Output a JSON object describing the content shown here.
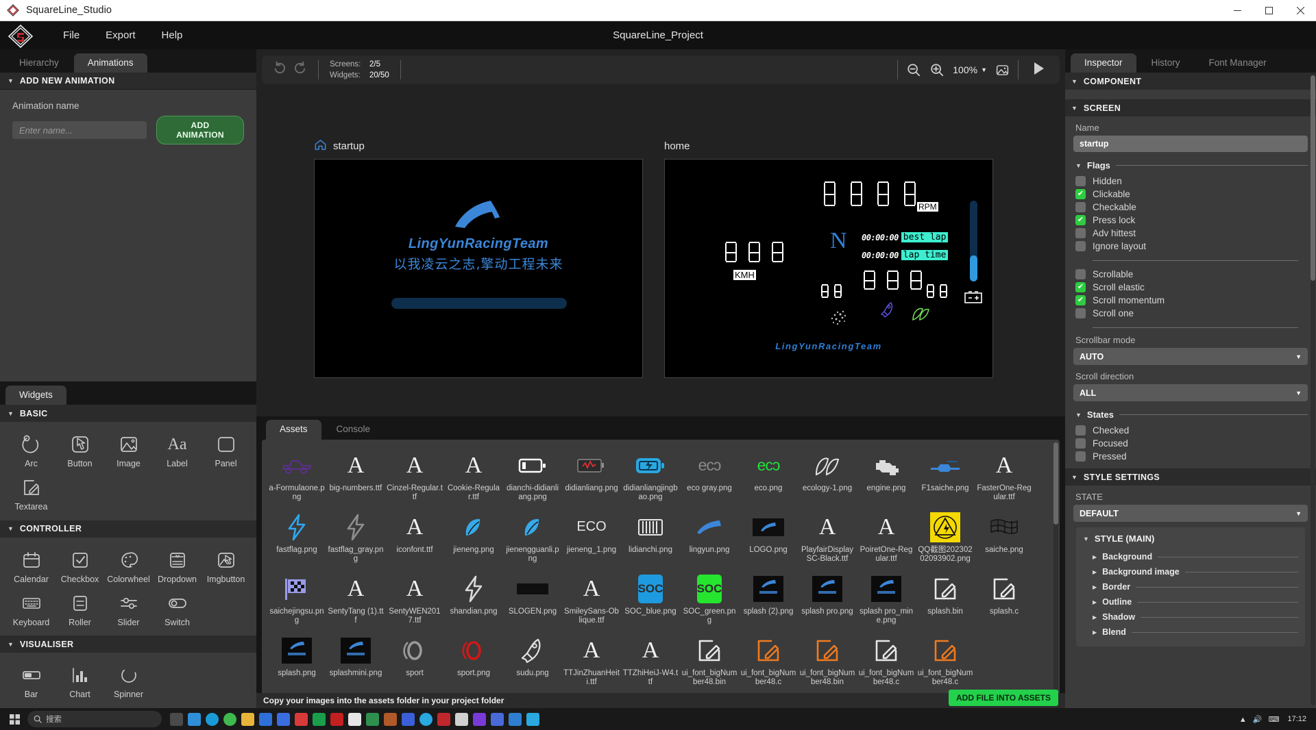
{
  "titlebar": {
    "app_name": "SquareLine_Studio",
    "minimize": "—",
    "maximize": "□",
    "close": "✕"
  },
  "menubar": {
    "items": [
      "File",
      "Export",
      "Help"
    ],
    "project_title": "SquareLine_Project"
  },
  "left_panel": {
    "tabs": [
      {
        "label": "Hierarchy",
        "active": false
      },
      {
        "label": "Animations",
        "active": true
      }
    ],
    "section_title": "ADD NEW ANIMATION",
    "animation_name_label": "Animation name",
    "animation_name_value": "",
    "animation_name_placeholder": "Enter name...",
    "add_animation_button": "ADD ANIMATION"
  },
  "widgets_panel": {
    "tab": "Widgets",
    "groups": [
      {
        "title": "BASIC",
        "items": [
          {
            "label": "Arc",
            "icon": "arc-icon"
          },
          {
            "label": "Button",
            "icon": "button-icon"
          },
          {
            "label": "Image",
            "icon": "image-icon"
          },
          {
            "label": "Label",
            "icon": "label-icon"
          },
          {
            "label": "Panel",
            "icon": "panel-icon"
          },
          {
            "label": "Textarea",
            "icon": "textarea-icon"
          }
        ]
      },
      {
        "title": "CONTROLLER",
        "items": [
          {
            "label": "Calendar",
            "icon": "calendar-icon"
          },
          {
            "label": "Checkbox",
            "icon": "checkbox-icon"
          },
          {
            "label": "Colorwheel",
            "icon": "colorwheel-icon"
          },
          {
            "label": "Dropdown",
            "icon": "dropdown-icon"
          },
          {
            "label": "Imgbutton",
            "icon": "imgbutton-icon"
          },
          {
            "label": "Keyboard",
            "icon": "keyboard-icon"
          },
          {
            "label": "Roller",
            "icon": "roller-icon"
          },
          {
            "label": "Slider",
            "icon": "slider-icon"
          },
          {
            "label": "Switch",
            "icon": "switch-icon"
          }
        ]
      },
      {
        "title": "VISUALISER",
        "items": [
          {
            "label": "Bar",
            "icon": "bar-icon"
          },
          {
            "label": "Chart",
            "icon": "chart-icon"
          },
          {
            "label": "Spinner",
            "icon": "spinner-icon"
          }
        ]
      }
    ]
  },
  "canvas": {
    "counts": {
      "screens_key": "Screens:",
      "screens_value": "2/5",
      "widgets_key": "Widgets:",
      "widgets_value": "20/50"
    },
    "zoom_level": "100%",
    "screens": [
      {
        "name": "startup",
        "is_home": true
      },
      {
        "name": "home",
        "is_home": false
      }
    ],
    "startup_screen": {
      "team_name": "LingYunRacingTeam",
      "slogan": "以我凌云之志,擎动工程未来"
    },
    "home_screen": {
      "rpm_digits": "0000",
      "rpm_label": "RPM",
      "speed_digits": "000",
      "speed_label": "KMH",
      "gear": "N",
      "best_lap_time": "00:00:00",
      "best_lap_label": "best lap",
      "lap_time_value": "00:00:00",
      "lap_time_label": "lap time",
      "small_left": "00",
      "center_digits": "000",
      "small_right": "00",
      "footer_text": "LingYunRacingTeam"
    }
  },
  "assets_panel": {
    "tabs": [
      {
        "label": "Assets",
        "active": true
      },
      {
        "label": "Console",
        "active": false
      }
    ],
    "footer_hint": "Copy your images into the assets folder in your project folder",
    "add_file_button": "ADD FILE INTO ASSETS",
    "items": [
      {
        "name": "a-Formulaone.png",
        "icon": "racecar-icon",
        "color": "#5b2f8e"
      },
      {
        "name": "big-numbers.ttf",
        "icon": "font-icon",
        "color": "#f2f2f2"
      },
      {
        "name": "Cinzel-Regular.ttf",
        "icon": "font-icon",
        "color": "#f2f2f2"
      },
      {
        "name": "Cookie-Regular.ttf",
        "icon": "font-icon",
        "color": "#f2f2f2"
      },
      {
        "name": "dianchi-didianliang.png",
        "icon": "battery-icon",
        "color": "#ffffff"
      },
      {
        "name": "didianliang.png",
        "icon": "battery-low-icon",
        "color": "#e03030"
      },
      {
        "name": "didianliangjingbao.png",
        "icon": "battery-charge-icon",
        "color": "#29a8e0"
      },
      {
        "name": "eco gray.png",
        "icon": "eco-icon",
        "color": "#8a8a8a"
      },
      {
        "name": "eco.png",
        "icon": "eco-icon",
        "color": "#23e03a"
      },
      {
        "name": "ecology-1.png",
        "icon": "leaf-icon",
        "color": "#e4e4e4"
      },
      {
        "name": "engine.png",
        "icon": "engine-icon",
        "color": "#dcdcdc"
      },
      {
        "name": "F1saiche.png",
        "icon": "f1car-icon",
        "color": "#3b86d8"
      },
      {
        "name": "FasterOne-Regular.ttf",
        "icon": "font-icon",
        "color": "#f2f2f2"
      },
      {
        "name": "fastflag.png",
        "icon": "lightning-icon",
        "color": "#2fa8f0"
      },
      {
        "name": "fastflag_gray.png",
        "icon": "lightning-icon",
        "color": "#8f8f8f"
      },
      {
        "name": "iconfont.ttf",
        "icon": "font-icon",
        "color": "#f2f2f2"
      },
      {
        "name": "jieneng.png",
        "icon": "leaf-blue-icon",
        "color": "#36a9e8"
      },
      {
        "name": "jienengguanli.png",
        "icon": "leaf-blue-icon",
        "color": "#36a9e8"
      },
      {
        "name": "jieneng_1.png",
        "icon": "eco-text-icon",
        "color": "#e6e6e6"
      },
      {
        "name": "lidianchi.png",
        "icon": "battery-cells-icon",
        "color": "#e6e6e6"
      },
      {
        "name": "lingyun.png",
        "icon": "swoosh-icon",
        "color": "#3b86d8"
      },
      {
        "name": "LOGO.png",
        "icon": "logo-icon",
        "color": "#3b86d8"
      },
      {
        "name": "PlayfairDisplaySC-Black.ttf",
        "icon": "font-icon",
        "color": "#f2f2f2"
      },
      {
        "name": "PoiretOne-Regular.ttf",
        "icon": "font-icon",
        "color": "#f2f2f2"
      },
      {
        "name": "QQ截图20230202093902.png",
        "icon": "warning-icon",
        "color": "#f5d800"
      },
      {
        "name": "saiche.png",
        "icon": "checkered-flag-icon",
        "color": "#222222"
      },
      {
        "name": "saichejingsu.png",
        "icon": "race-flag-icon",
        "color": "#9a9ae8"
      },
      {
        "name": "SentyTang (1).ttf",
        "icon": "font-icon",
        "color": "#f2f2f2"
      },
      {
        "name": "SentyWEN2017.ttf",
        "icon": "font-icon",
        "color": "#f2f2f2"
      },
      {
        "name": "shandian.png",
        "icon": "lightning-icon",
        "color": "#dadada"
      },
      {
        "name": "SLOGEN.png",
        "icon": "slogan-icon",
        "color": "#3b86d8"
      },
      {
        "name": "SmileySans-Oblique.ttf",
        "icon": "font-icon",
        "color": "#f2f2f2"
      },
      {
        "name": "SOC_blue.png",
        "icon": "soc-icon",
        "color": "#1e9be0"
      },
      {
        "name": "SOC_green.png",
        "icon": "soc-icon",
        "color": "#25e52f"
      },
      {
        "name": "splash (2).png",
        "icon": "splash-icon",
        "color": "#3b86d8"
      },
      {
        "name": "splash pro.png",
        "icon": "splash-icon",
        "color": "#3b86d8"
      },
      {
        "name": "splash pro_mine.png",
        "icon": "splash-icon",
        "color": "#3b86d8"
      },
      {
        "name": "splash.bin",
        "icon": "edit-icon",
        "color": "#e8e8e8"
      },
      {
        "name": "splash.c",
        "icon": "edit-icon",
        "color": "#e8e8e8"
      },
      {
        "name": "splash.png",
        "icon": "splash-icon",
        "color": "#3b86d8"
      },
      {
        "name": "splashmini.png",
        "icon": "splash-icon",
        "color": "#3b86d8"
      },
      {
        "name": "sport",
        "icon": "sport-icon",
        "color": "#9a9a9a"
      },
      {
        "name": "sport.png",
        "icon": "sport-icon",
        "color": "#d01818"
      },
      {
        "name": "sudu.png",
        "icon": "rocket-icon",
        "color": "#e2e2e2"
      },
      {
        "name": "TTJinZhuanHeiti.ttf",
        "icon": "font-icon",
        "color": "#f2f2f2"
      },
      {
        "name": "TTZhiHeiJ-W4.ttf",
        "icon": "font-icon",
        "color": "#f2f2f2"
      },
      {
        "name": "ui_font_bigNumber48.bin",
        "icon": "edit-icon",
        "color": "#e8e8e8"
      },
      {
        "name": "ui_font_bigNumber48.c",
        "icon": "edit-icon",
        "color": "#f07a1e"
      },
      {
        "name": "ui_font_bigNumber48.bin",
        "icon": "edit-icon",
        "color": "#f07a1e"
      },
      {
        "name": "ui_font_bigNumber48.c",
        "icon": "edit-icon",
        "color": "#e8e8e8"
      },
      {
        "name": "ui_font_bigNumber48.c",
        "icon": "edit-icon",
        "color": "#f07a1e"
      }
    ]
  },
  "inspector": {
    "tabs": [
      {
        "label": "Inspector",
        "active": true
      },
      {
        "label": "History",
        "active": false
      },
      {
        "label": "Font Manager",
        "active": false
      }
    ],
    "component_section": "COMPONENT",
    "screen_section": "SCREEN",
    "name_label": "Name",
    "name_value": "startup",
    "flags_title": "Flags",
    "flags": [
      {
        "label": "Hidden",
        "checked": false
      },
      {
        "label": "Clickable",
        "checked": true
      },
      {
        "label": "Checkable",
        "checked": false
      },
      {
        "label": "Press lock",
        "checked": true
      },
      {
        "label": "Adv hittest",
        "checked": false
      },
      {
        "label": "Ignore layout",
        "checked": false
      }
    ],
    "scroll_flags": [
      {
        "label": "Scrollable",
        "checked": false
      },
      {
        "label": "Scroll elastic",
        "checked": true
      },
      {
        "label": "Scroll momentum",
        "checked": true
      },
      {
        "label": "Scroll one",
        "checked": false
      }
    ],
    "scrollbar_mode_label": "Scrollbar mode",
    "scrollbar_mode_value": "AUTO",
    "scroll_direction_label": "Scroll direction",
    "scroll_direction_value": "ALL",
    "states_title": "States",
    "states": [
      {
        "label": "Checked",
        "checked": false
      },
      {
        "label": "Focused",
        "checked": false
      },
      {
        "label": "Pressed",
        "checked": false
      }
    ],
    "style_settings_section": "STYLE SETTINGS",
    "state_label": "STATE",
    "state_value": "DEFAULT",
    "style_main_title": "STYLE (MAIN)",
    "style_rows": [
      "Background",
      "Background image",
      "Border",
      "Outline",
      "Shadow",
      "Blend"
    ]
  },
  "taskbar": {
    "search_placeholder": "搜索",
    "clock_time": "17:12",
    "clock_date": ""
  },
  "colors": {
    "accent_green": "#23d14b",
    "panel_bg": "#3b3b3b",
    "header_bg": "#2b2b2b",
    "brand_blue": "#3b86d8",
    "cyan": "#3defd0"
  }
}
